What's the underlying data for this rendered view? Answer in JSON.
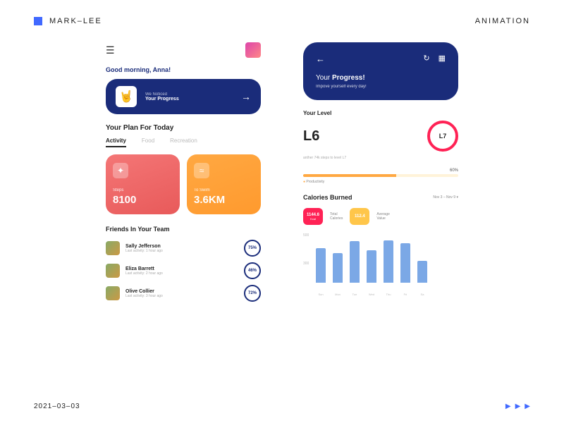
{
  "header": {
    "brand": "MARK–LEE",
    "right": "ANIMATION"
  },
  "left": {
    "greeting": "Good morning, Anna!",
    "notice": {
      "small": "We Noticed",
      "big": "Your Progress"
    },
    "planTitle": "Your Plan For Today",
    "tabs": [
      "Activity",
      "Food",
      "Recreation"
    ],
    "cards": [
      {
        "label": "Steps",
        "value": "8100"
      },
      {
        "label": "To Swim",
        "value": "3.6KM"
      }
    ],
    "friendsTitle": "Friends In Your Team",
    "friends": [
      {
        "name": "Sally Jefferson",
        "sub": "Last activity: 1 hour ago",
        "pct": "75%"
      },
      {
        "name": "Eliza Barrett",
        "sub": "Last activity: 2 hour ago",
        "pct": "46%"
      },
      {
        "name": "Olive Collier",
        "sub": "Last activity: 3 hour ago",
        "pct": "72%"
      }
    ]
  },
  "right": {
    "progTitlePre": "Your ",
    "progTitleB": "Progress!",
    "progSub": "Impove yourself every day!",
    "levelTitle": "Your Level",
    "levelCur": "L6",
    "levelNext": "L7",
    "levelSub": "anther 74k steps to level L7",
    "percent": "60%",
    "prodLabel": "Productivity",
    "calTitle": "Calories Burned",
    "calRange": "Nov 3 – Nov 9 ▾",
    "stats": [
      {
        "value": "1144.6",
        "unit": "Kcal",
        "l1": "Total",
        "l2": "Calories"
      },
      {
        "value": "112.4",
        "unit": "",
        "l1": "Average",
        "l2": "Value"
      }
    ],
    "yMax": "500",
    "yMid": "300"
  },
  "footer": {
    "date": "2021–03–03"
  },
  "chart_data": {
    "type": "bar",
    "categories": [
      "Sun",
      "Mon",
      "Tue",
      "Wed",
      "Thu",
      "Fri",
      "Sa"
    ],
    "values": [
      350,
      300,
      420,
      330,
      430,
      400,
      220
    ],
    "title": "Calories Burned",
    "ylabel": "",
    "ylim": [
      0,
      500
    ]
  }
}
